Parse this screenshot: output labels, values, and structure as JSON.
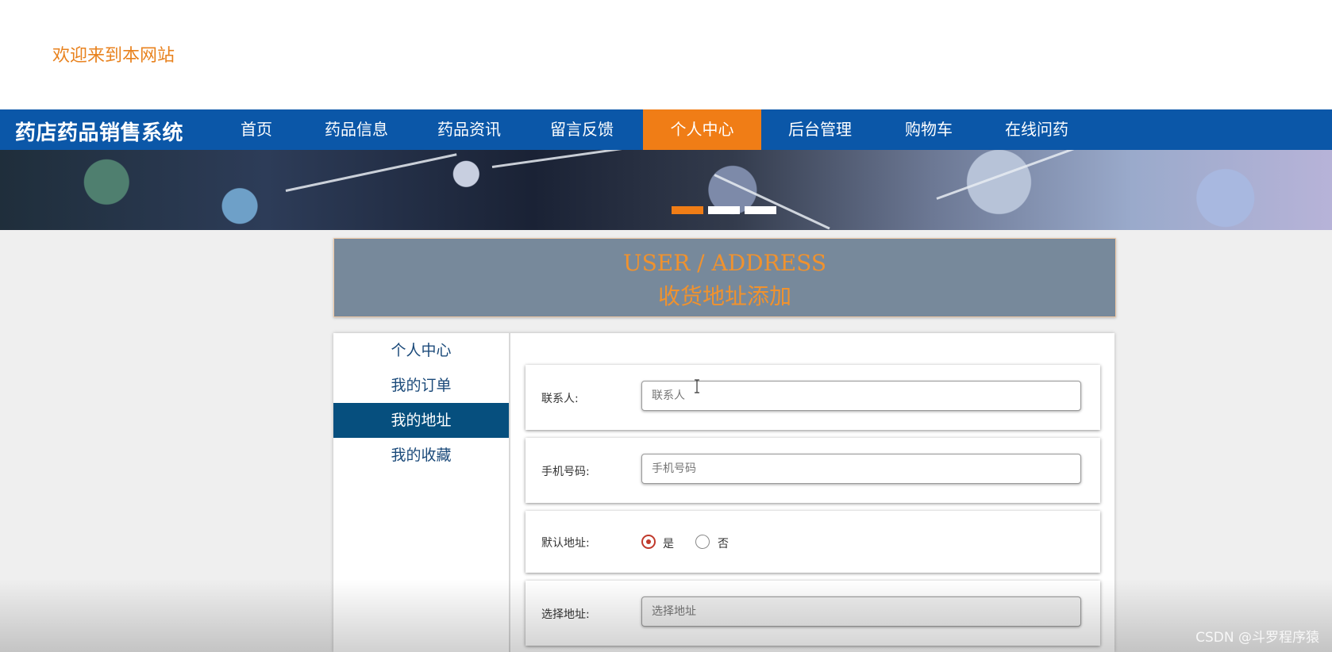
{
  "header": {
    "welcome": "欢迎来到本网站"
  },
  "nav": {
    "brand": "药店药品销售系统",
    "items": [
      {
        "label": "首页"
      },
      {
        "label": "药品信息"
      },
      {
        "label": "药品资讯"
      },
      {
        "label": "留言反馈"
      },
      {
        "label": "个人中心",
        "active": true
      },
      {
        "label": "后台管理"
      },
      {
        "label": "购物车"
      },
      {
        "label": "在线问药"
      }
    ]
  },
  "page": {
    "title_en": "USER / ADDRESS",
    "title_cn": "收货地址添加"
  },
  "sidebar": {
    "items": [
      {
        "label": "个人中心"
      },
      {
        "label": "我的订单"
      },
      {
        "label": "我的地址",
        "active": true
      },
      {
        "label": "我的收藏"
      }
    ]
  },
  "form": {
    "contact": {
      "label": "联系人:",
      "placeholder": "联系人",
      "value": ""
    },
    "phone": {
      "label": "手机号码:",
      "placeholder": "手机号码",
      "value": ""
    },
    "default": {
      "label": "默认地址:",
      "options": [
        "是",
        "否"
      ],
      "selected": "是"
    },
    "address": {
      "label": "选择地址:",
      "placeholder": "选择地址"
    }
  },
  "watermark": "CSDN @斗罗程序猿",
  "colors": {
    "nav_bg": "#0b57a8",
    "accent": "#f07d16",
    "sidebar_active": "#064f7e",
    "title_bg": "#77899b"
  }
}
